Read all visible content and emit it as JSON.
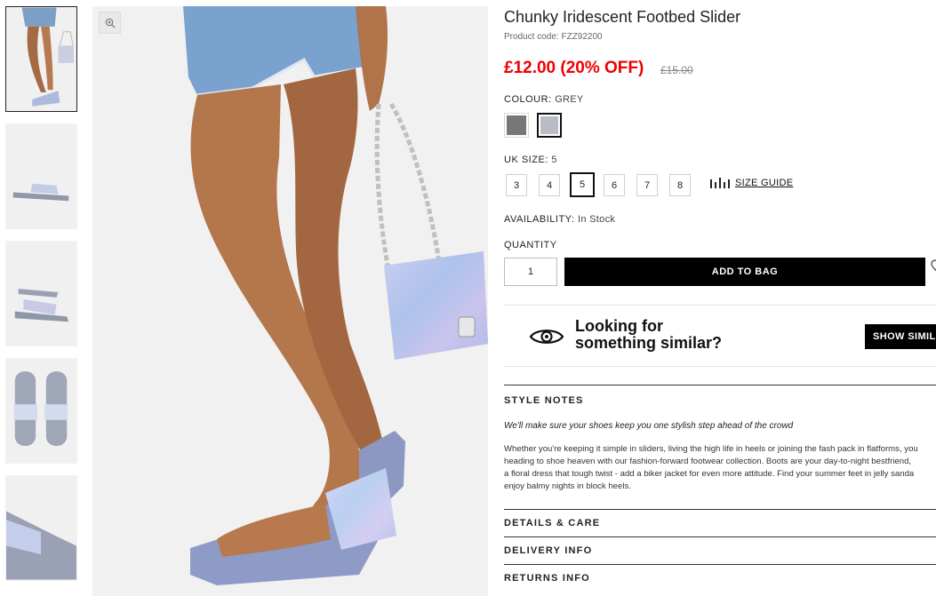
{
  "thumbnails": [
    {
      "alt": "thumbnail-1"
    },
    {
      "alt": "thumbnail-2"
    },
    {
      "alt": "thumbnail-3"
    },
    {
      "alt": "thumbnail-4"
    },
    {
      "alt": "thumbnail-5"
    }
  ],
  "product": {
    "title": "Chunky Iridescent Footbed Slider",
    "code": "Product code: FZZ92200",
    "price": "£12.00 (20% OFF)",
    "old_price": "£15.00"
  },
  "colour": {
    "label": "COLOUR:",
    "value": "GREY",
    "swatches": [
      "#777777",
      "#b9bcc4"
    ]
  },
  "size": {
    "label": "UK SIZE:",
    "value": "5",
    "options": [
      "3",
      "4",
      "5",
      "6",
      "7",
      "8"
    ],
    "guide": "SIZE GUIDE"
  },
  "availability": {
    "label": "AVAILABILITY:",
    "value": "In Stock"
  },
  "quantity": {
    "label": "QUANTITY",
    "value": "1"
  },
  "add_to_bag": "ADD TO BAG",
  "similar": {
    "line1": "Looking for",
    "line2": "something similar?",
    "button": "SHOW SIMILAR"
  },
  "style_notes": {
    "title": "STYLE NOTES",
    "tagline": "We'll make sure your shoes keep you one stylish step ahead of the crowd",
    "lines": [
      "Whether you're keeping it simple in sliders, living the high life in heels or joining the fash pack in flatforms, you",
      "heading to shoe heaven with our fashion-forward footwear collection. Boots are your day-to-night bestfriend,",
      "a floral dress that tough twist - add a biker jacket for even more attitude. Find your summer feet in jelly sanda",
      "enjoy balmy nights in block heels."
    ]
  },
  "sections": [
    "DETAILS & CARE",
    "DELIVERY INFO",
    "RETURNS INFO"
  ],
  "colors": {
    "sale": "#ee0000",
    "black": "#000000"
  }
}
